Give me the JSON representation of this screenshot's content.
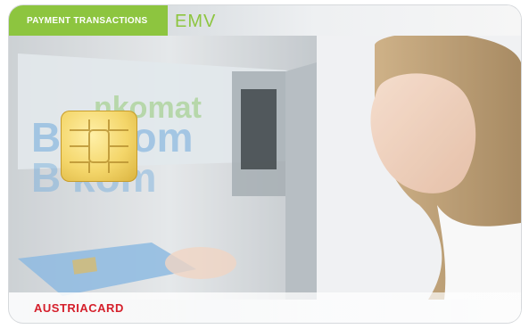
{
  "card": {
    "header_label": "PAYMENT TRANSACTIONS",
    "standard_label": "EMV",
    "brand_text": "AUSTRIACARD"
  },
  "colors": {
    "accent_green": "#8dc53f",
    "brand_red": "#d51f2b"
  }
}
